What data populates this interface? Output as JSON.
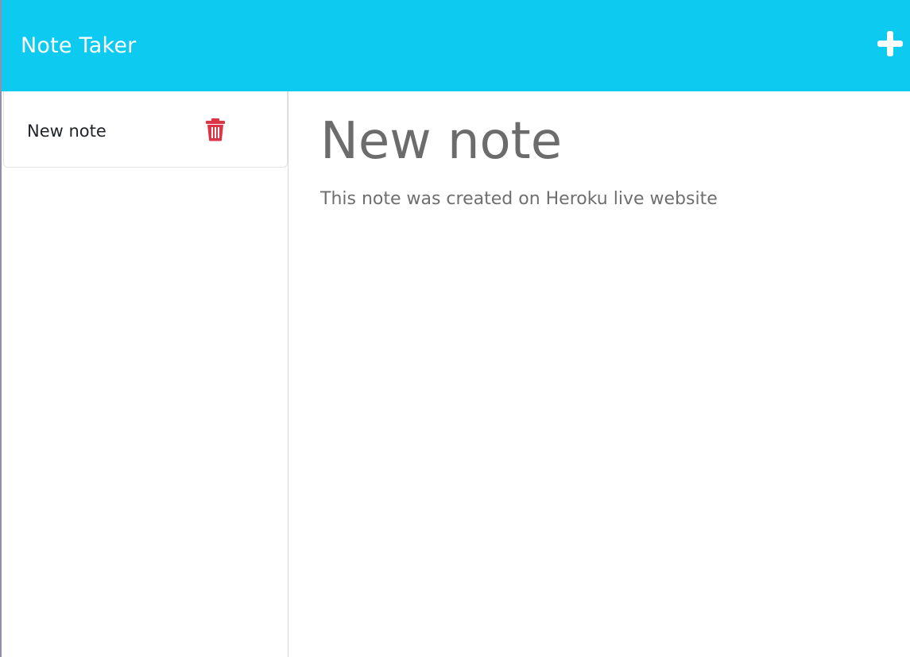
{
  "app": {
    "title": "Note Taker",
    "accent_color": "#0dcaf0",
    "delete_color": "#dc3545"
  },
  "header": {
    "add_icon": "plus-icon"
  },
  "sidebar": {
    "notes": [
      {
        "title": "New note",
        "delete_icon": "trash-icon"
      }
    ]
  },
  "editor": {
    "title_value": "New note",
    "text_value": "This note was created on Heroku live website"
  }
}
